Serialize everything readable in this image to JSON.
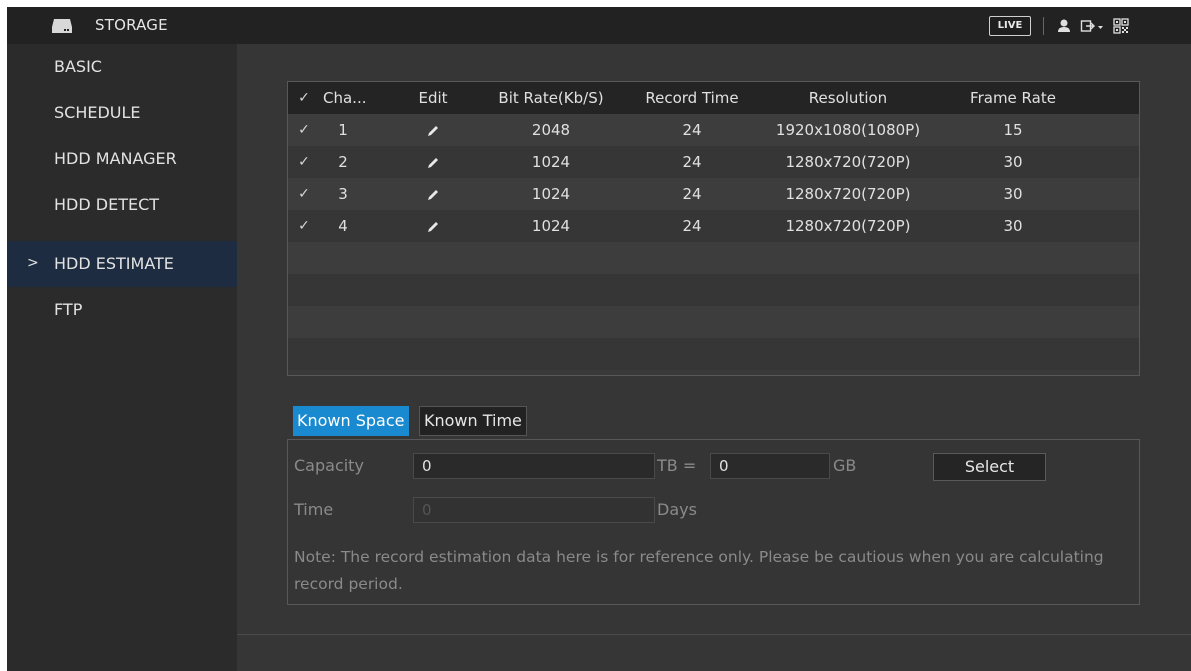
{
  "header": {
    "title": "STORAGE",
    "live_label": "LIVE",
    "icons": [
      "storage-icon",
      "user-icon",
      "logout-icon",
      "qr-code-icon"
    ]
  },
  "sidebar": {
    "items": [
      {
        "label": "BASIC",
        "active": false
      },
      {
        "label": "SCHEDULE",
        "active": false
      },
      {
        "label": "HDD MANAGER",
        "active": false
      },
      {
        "label": "HDD DETECT",
        "active": false
      },
      {
        "label": "HDD ESTIMATE",
        "active": true
      },
      {
        "label": "FTP",
        "active": false
      }
    ],
    "active_marker": ">"
  },
  "table": {
    "columns": [
      "Cha...",
      "Edit",
      "Bit Rate(Kb/S)",
      "Record Time",
      "Resolution",
      "Frame Rate"
    ],
    "header_checked": true,
    "check_glyph": "✓",
    "rows": [
      {
        "checked": true,
        "channel": "1",
        "bit_rate": "2048",
        "record_time": "24",
        "resolution": "1920x1080(1080P)",
        "frame_rate": "15"
      },
      {
        "checked": true,
        "channel": "2",
        "bit_rate": "1024",
        "record_time": "24",
        "resolution": "1280x720(720P)",
        "frame_rate": "30"
      },
      {
        "checked": true,
        "channel": "3",
        "bit_rate": "1024",
        "record_time": "24",
        "resolution": "1280x720(720P)",
        "frame_rate": "30"
      },
      {
        "checked": true,
        "channel": "4",
        "bit_rate": "1024",
        "record_time": "24",
        "resolution": "1280x720(720P)",
        "frame_rate": "30"
      }
    ]
  },
  "modes": {
    "known_space": "Known Space",
    "known_time": "Known Time",
    "selected": "Known Space"
  },
  "estimate": {
    "capacity_label": "Capacity",
    "capacity_tb_value": "0",
    "tb_eq_label": "TB =",
    "capacity_gb_value": "0",
    "gb_label": "GB",
    "select_label": "Select",
    "time_label": "Time",
    "time_value": "0",
    "days_label": "Days",
    "note": "Note: The record estimation data here is for reference only. Please be cautious when you are calculating record period."
  },
  "colors": {
    "accent": "#1a8ad0",
    "active_sidebar": "#1d2c40"
  }
}
